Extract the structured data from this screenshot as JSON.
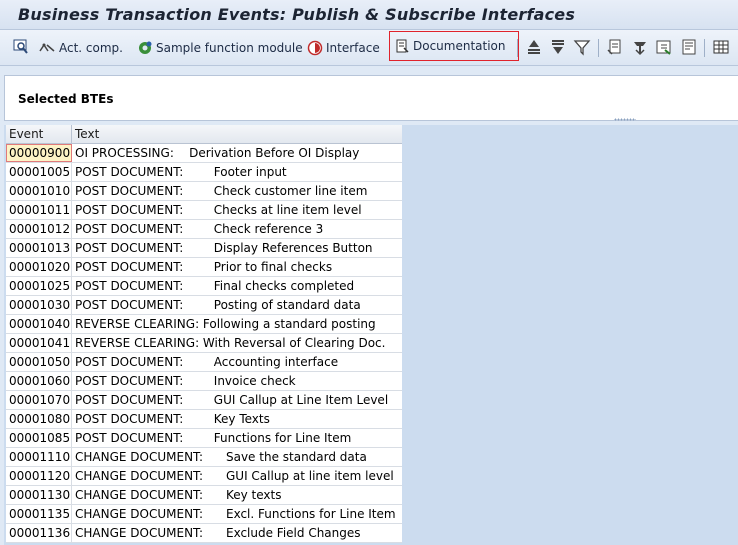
{
  "window": {
    "title": "Business Transaction Events: Publish & Subscribe Interfaces"
  },
  "toolbar": {
    "act_comp": "Act. comp.",
    "sample_fm": "Sample function module",
    "interface": "Interface",
    "documentation": "Documentation"
  },
  "panel": {
    "selected_label": "Selected BTEs"
  },
  "grid": {
    "headers": {
      "event": "Event",
      "text": "Text"
    },
    "rows": [
      {
        "event": "00000900",
        "text": "OI PROCESSING:    Derivation Before OI Display"
      },
      {
        "event": "00001005",
        "text": "POST DOCUMENT:        Footer input"
      },
      {
        "event": "00001010",
        "text": "POST DOCUMENT:        Check customer line item"
      },
      {
        "event": "00001011",
        "text": "POST DOCUMENT:        Checks at line item level"
      },
      {
        "event": "00001012",
        "text": "POST DOCUMENT:        Check reference 3"
      },
      {
        "event": "00001013",
        "text": "POST DOCUMENT:        Display References Button"
      },
      {
        "event": "00001020",
        "text": "POST DOCUMENT:        Prior to final checks"
      },
      {
        "event": "00001025",
        "text": "POST DOCUMENT:        Final checks completed"
      },
      {
        "event": "00001030",
        "text": "POST DOCUMENT:        Posting of standard data"
      },
      {
        "event": "00001040",
        "text": "REVERSE CLEARING: Following a standard posting"
      },
      {
        "event": "00001041",
        "text": "REVERSE CLEARING: With Reversal of Clearing Doc."
      },
      {
        "event": "00001050",
        "text": "POST DOCUMENT:        Accounting interface"
      },
      {
        "event": "00001060",
        "text": "POST DOCUMENT:        Invoice check"
      },
      {
        "event": "00001070",
        "text": "POST DOCUMENT:        GUI Callup at Line Item Level"
      },
      {
        "event": "00001080",
        "text": "POST DOCUMENT:        Key Texts"
      },
      {
        "event": "00001085",
        "text": "POST DOCUMENT:        Functions for Line Item"
      },
      {
        "event": "00001110",
        "text": "CHANGE DOCUMENT:      Save the standard data"
      },
      {
        "event": "00001120",
        "text": "CHANGE DOCUMENT:      GUI Callup at line item level"
      },
      {
        "event": "00001130",
        "text": "CHANGE DOCUMENT:      Key texts"
      },
      {
        "event": "00001135",
        "text": "CHANGE DOCUMENT:      Excl. Functions for Line Item"
      },
      {
        "event": "00001136",
        "text": "CHANGE DOCUMENT:      Exclude Field Changes"
      }
    ]
  }
}
